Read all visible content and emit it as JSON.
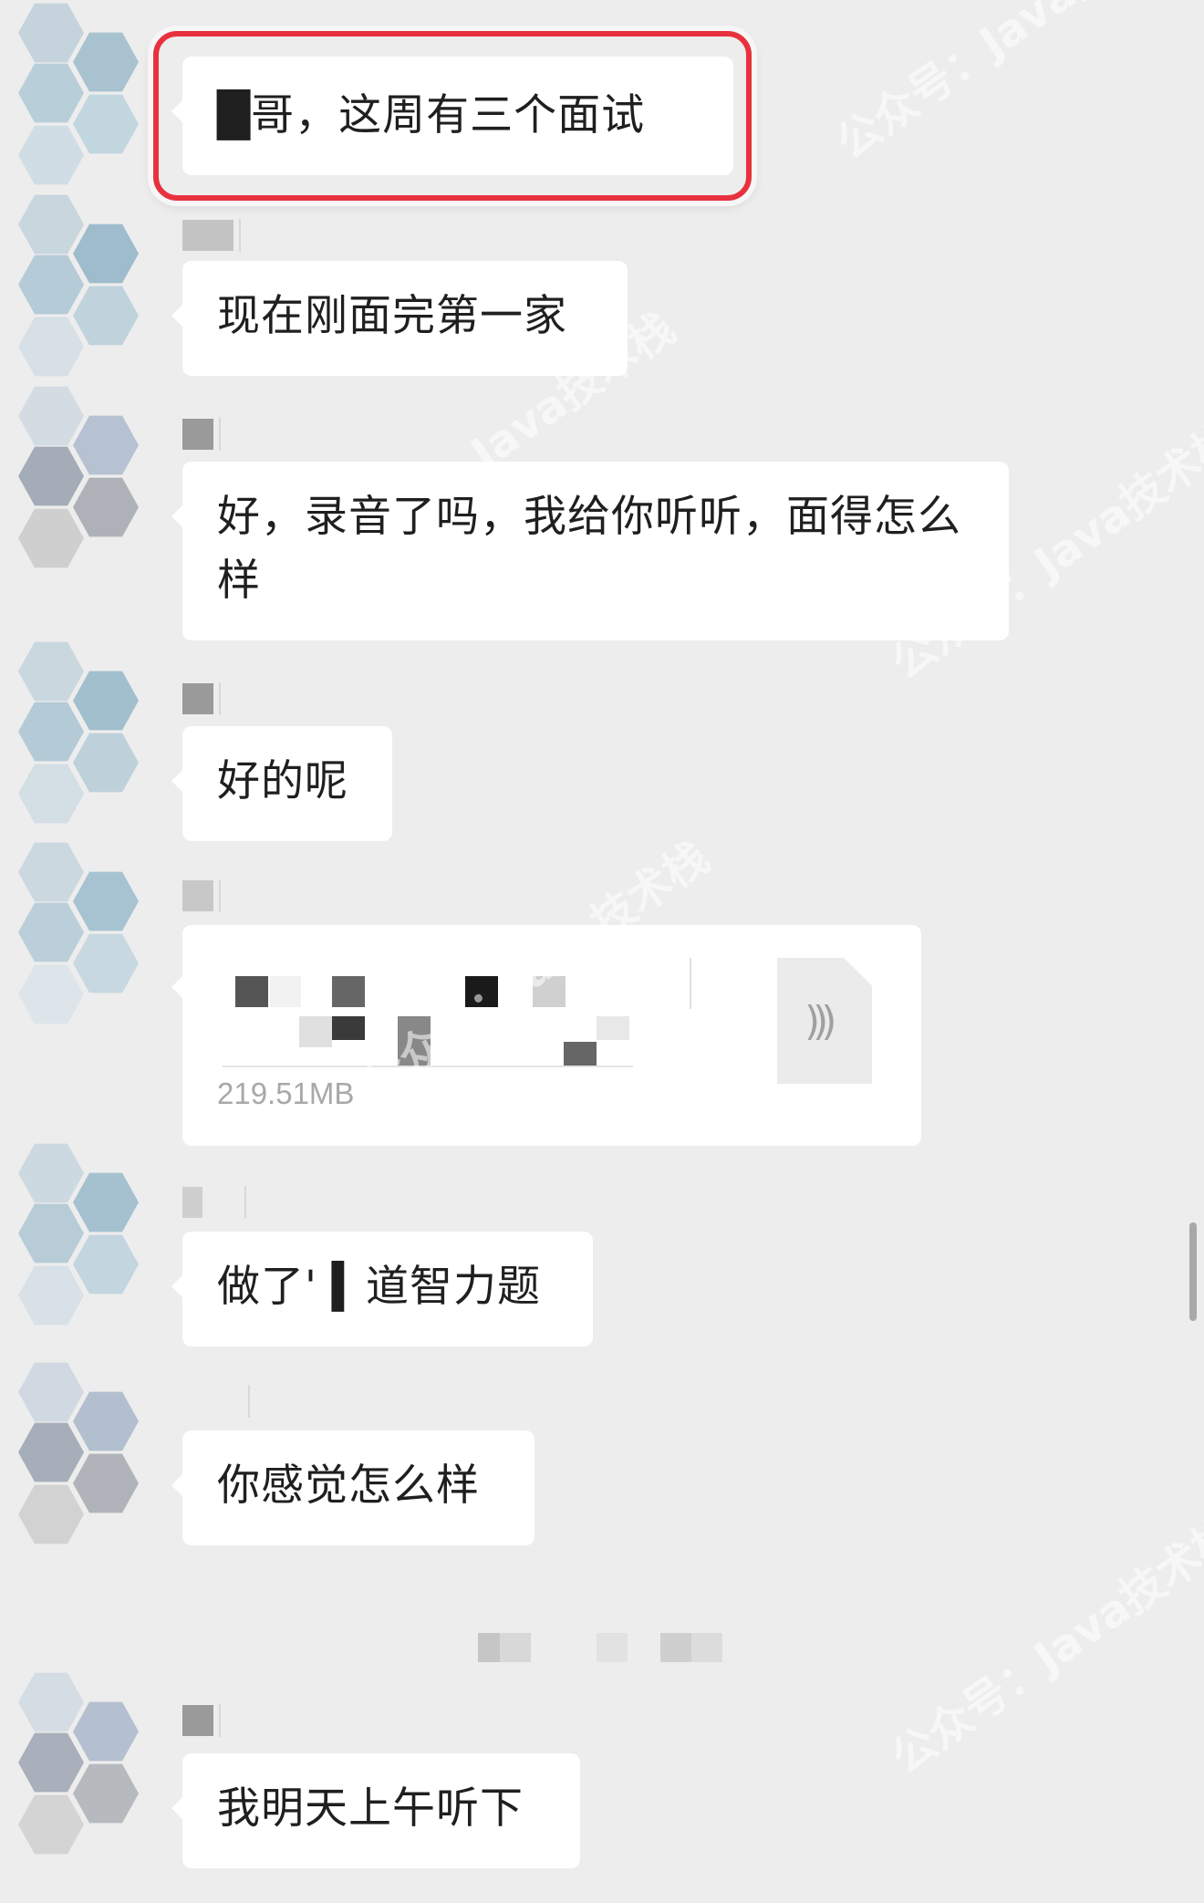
{
  "messages": [
    {
      "id": "m1",
      "text": "█哥，这周有三个面试"
    },
    {
      "id": "m2",
      "text": "现在刚面完第一家"
    },
    {
      "id": "m3",
      "text": "好，录音了吗，我给你听听，面得怎么样"
    },
    {
      "id": "m4",
      "text": "好的呢"
    },
    {
      "id": "m6",
      "text": "做了'  ▍道智力题"
    },
    {
      "id": "m7",
      "text": "你感觉怎么样"
    },
    {
      "id": "m8",
      "text": "我明天上午听下"
    }
  ],
  "file": {
    "size": "219.51MB",
    "icon": "audio-file-icon"
  },
  "watermarks": [
    "公众号：Java技术栈",
    "Java技术栈",
    "公众号：Java技术栈",
    "公众号：Java技术栈",
    "公众号：Java技术栈"
  ],
  "colors": {
    "background": "#ededed",
    "bubble": "#ffffff",
    "highlight": "#e8313f"
  }
}
